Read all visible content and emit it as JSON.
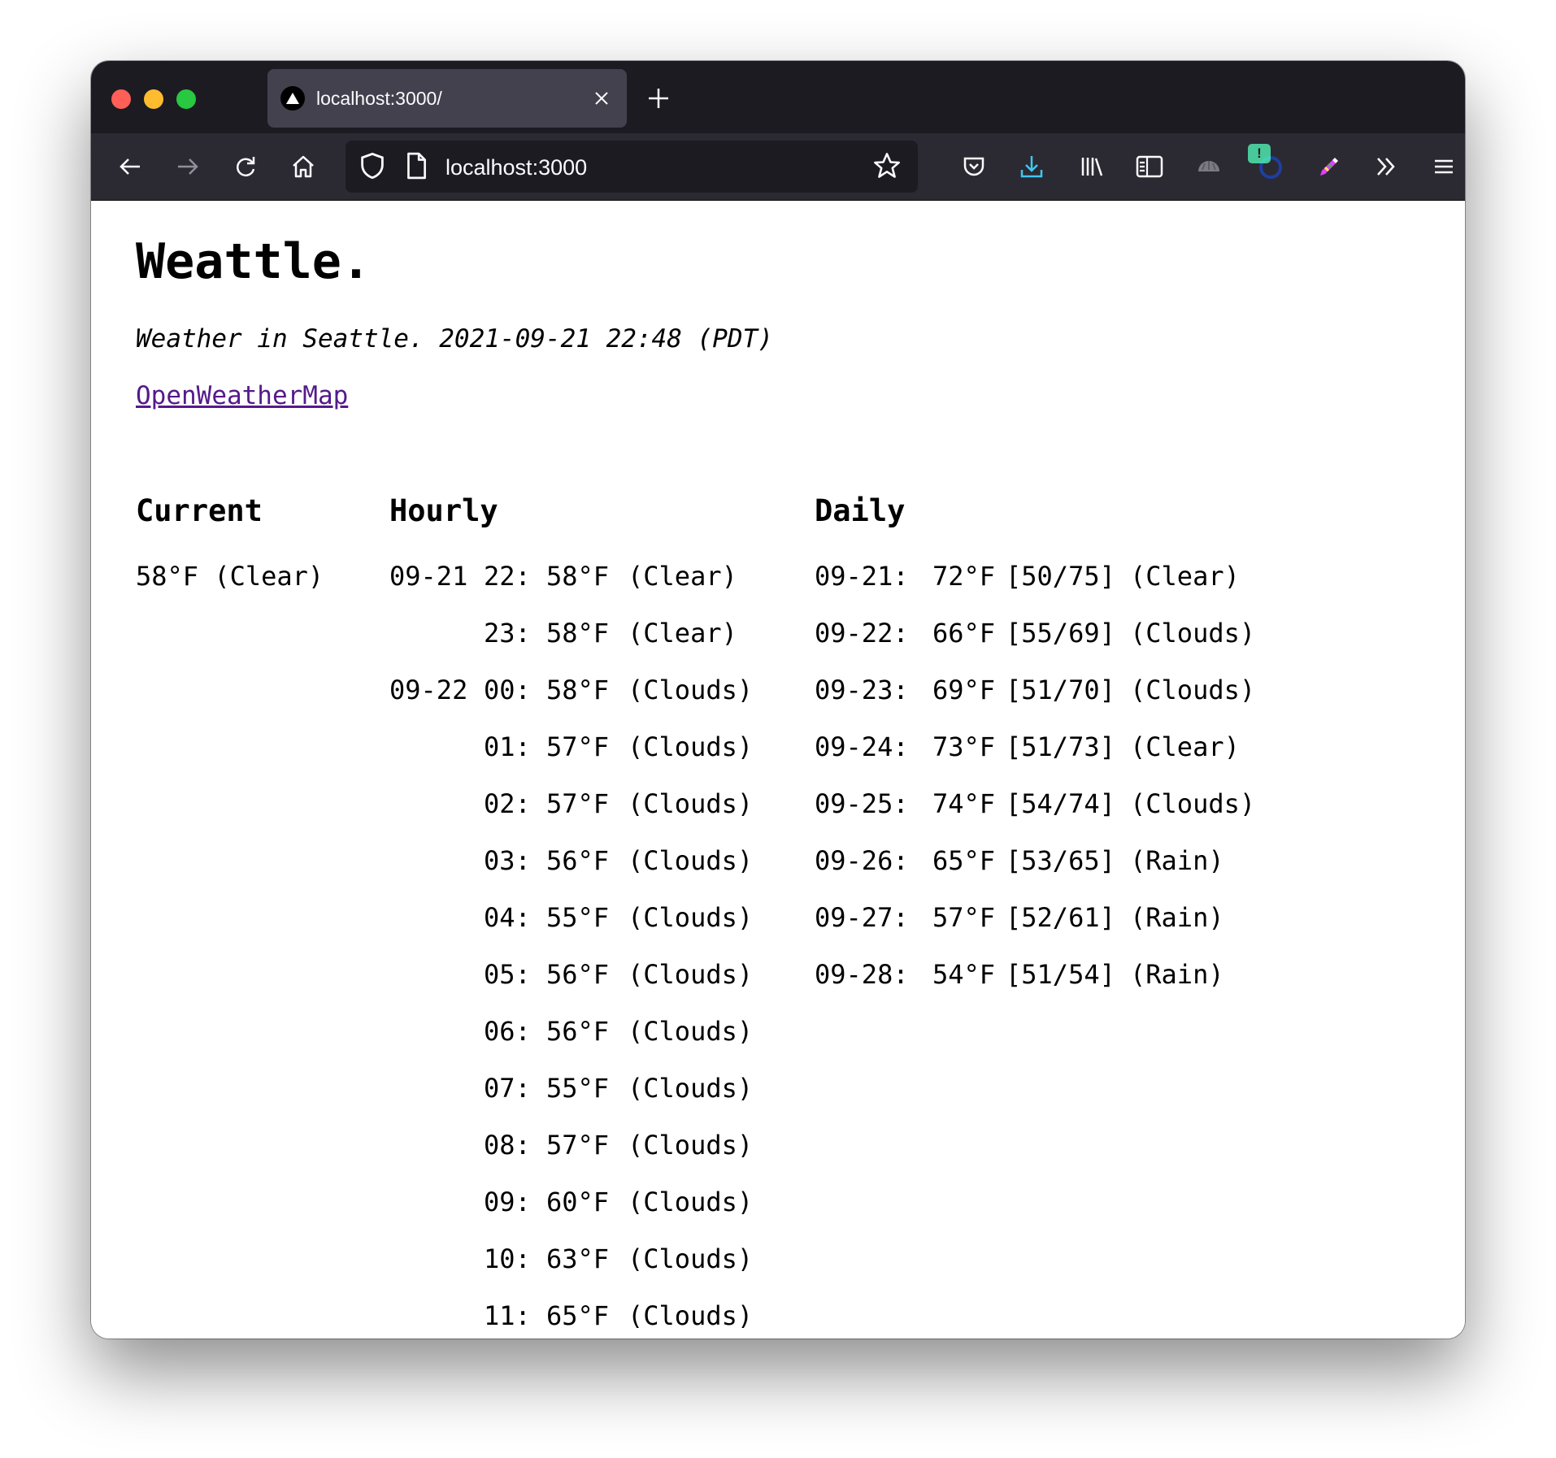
{
  "browser": {
    "tab_title": "localhost:3000/",
    "url": "localhost:3000"
  },
  "page": {
    "title": "Weattle.",
    "subtitle": "Weather in Seattle. 2021-09-21 22:48 (PDT)",
    "link_label": "OpenWeatherMap"
  },
  "current": {
    "heading": "Current",
    "value": "58°F (Clear)"
  },
  "hourly": {
    "heading": "Hourly",
    "rows": [
      {
        "date": "09-21",
        "hour": "22:",
        "temp": "58°F",
        "cond": "(Clear)"
      },
      {
        "date": "",
        "hour": "23:",
        "temp": "58°F",
        "cond": "(Clear)"
      },
      {
        "date": "09-22",
        "hour": "00:",
        "temp": "58°F",
        "cond": "(Clouds)"
      },
      {
        "date": "",
        "hour": "01:",
        "temp": "57°F",
        "cond": "(Clouds)"
      },
      {
        "date": "",
        "hour": "02:",
        "temp": "57°F",
        "cond": "(Clouds)"
      },
      {
        "date": "",
        "hour": "03:",
        "temp": "56°F",
        "cond": "(Clouds)"
      },
      {
        "date": "",
        "hour": "04:",
        "temp": "55°F",
        "cond": "(Clouds)"
      },
      {
        "date": "",
        "hour": "05:",
        "temp": "56°F",
        "cond": "(Clouds)"
      },
      {
        "date": "",
        "hour": "06:",
        "temp": "56°F",
        "cond": "(Clouds)"
      },
      {
        "date": "",
        "hour": "07:",
        "temp": "55°F",
        "cond": "(Clouds)"
      },
      {
        "date": "",
        "hour": "08:",
        "temp": "57°F",
        "cond": "(Clouds)"
      },
      {
        "date": "",
        "hour": "09:",
        "temp": "60°F",
        "cond": "(Clouds)"
      },
      {
        "date": "",
        "hour": "10:",
        "temp": "63°F",
        "cond": "(Clouds)"
      },
      {
        "date": "",
        "hour": "11:",
        "temp": "65°F",
        "cond": "(Clouds)"
      }
    ]
  },
  "daily": {
    "heading": "Daily",
    "rows": [
      {
        "date": "09-21:",
        "temp": "72°F",
        "range": "[50/75]",
        "cond": "(Clear)"
      },
      {
        "date": "09-22:",
        "temp": "66°F",
        "range": "[55/69]",
        "cond": "(Clouds)"
      },
      {
        "date": "09-23:",
        "temp": "69°F",
        "range": "[51/70]",
        "cond": "(Clouds)"
      },
      {
        "date": "09-24:",
        "temp": "73°F",
        "range": "[51/73]",
        "cond": "(Clear)"
      },
      {
        "date": "09-25:",
        "temp": "74°F",
        "range": "[54/74]",
        "cond": "(Clouds)"
      },
      {
        "date": "09-26:",
        "temp": "65°F",
        "range": "[53/65]",
        "cond": "(Rain)"
      },
      {
        "date": "09-27:",
        "temp": "57°F",
        "range": "[52/61]",
        "cond": "(Rain)"
      },
      {
        "date": "09-28:",
        "temp": "54°F",
        "range": "[51/54]",
        "cond": "(Rain)"
      }
    ]
  },
  "extension_badge": "!",
  "icons": [
    "back-icon",
    "forward-icon",
    "reload-icon",
    "home-icon",
    "shield-icon",
    "page-icon",
    "bookmark-star-icon",
    "pocket-icon",
    "downloads-icon",
    "library-icon",
    "sidebar-icon",
    "extension-icon",
    "account-icon",
    "color-picker-icon",
    "overflow-icon",
    "menu-icon"
  ]
}
